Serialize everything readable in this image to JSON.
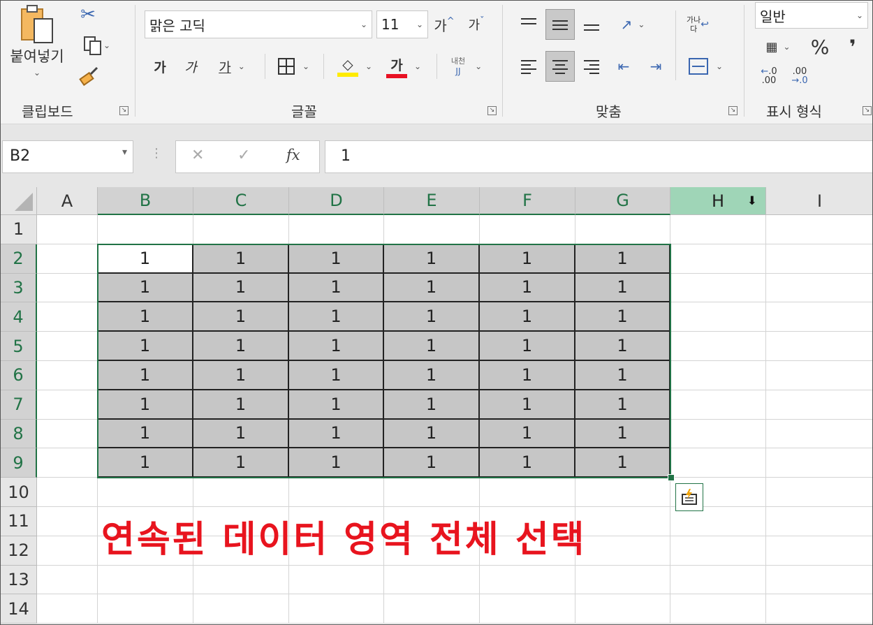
{
  "ribbon": {
    "clipboard": {
      "paste_label": "붙여넣기",
      "group_label": "클립보드"
    },
    "font": {
      "font_name": "맑은 고딕",
      "font_size": "11",
      "grow_label": "가",
      "shrink_label": "가",
      "bold_label": "가",
      "italic_label": "가",
      "underline_label": "가",
      "font_color_label": "가",
      "phonetic_top": "내천",
      "phonetic_bottom": "JJ",
      "group_label": "글꼴",
      "highlight_color": "#ffeb00",
      "font_color": "#e81123"
    },
    "alignment": {
      "wrap_top": "가나",
      "wrap_bottom": "다",
      "group_label": "맞춤"
    },
    "number": {
      "format": "일반",
      "percent": "%",
      "comma": "❜",
      "inc_decimal": ".0",
      "dec_decimal": ".00",
      "group_label": "표시 형식"
    }
  },
  "formula_bar": {
    "name_box": "B2",
    "fx": "fx",
    "cancel": "✕",
    "enter": "✓",
    "value": "1"
  },
  "columns": [
    "A",
    "B",
    "C",
    "D",
    "E",
    "F",
    "G",
    "H",
    "I"
  ],
  "rows": [
    "1",
    "2",
    "3",
    "4",
    "5",
    "6",
    "7",
    "8",
    "9",
    "10",
    "11",
    "12",
    "13",
    "14"
  ],
  "cells": {
    "value": "1"
  },
  "annotation": "연속된 데이터 영역 전체 선택",
  "colors": {
    "accent": "#217346",
    "annotation": "#e8141e",
    "selection_fill": "#c6c6c6",
    "header_highlight": "#9fd5b7"
  }
}
